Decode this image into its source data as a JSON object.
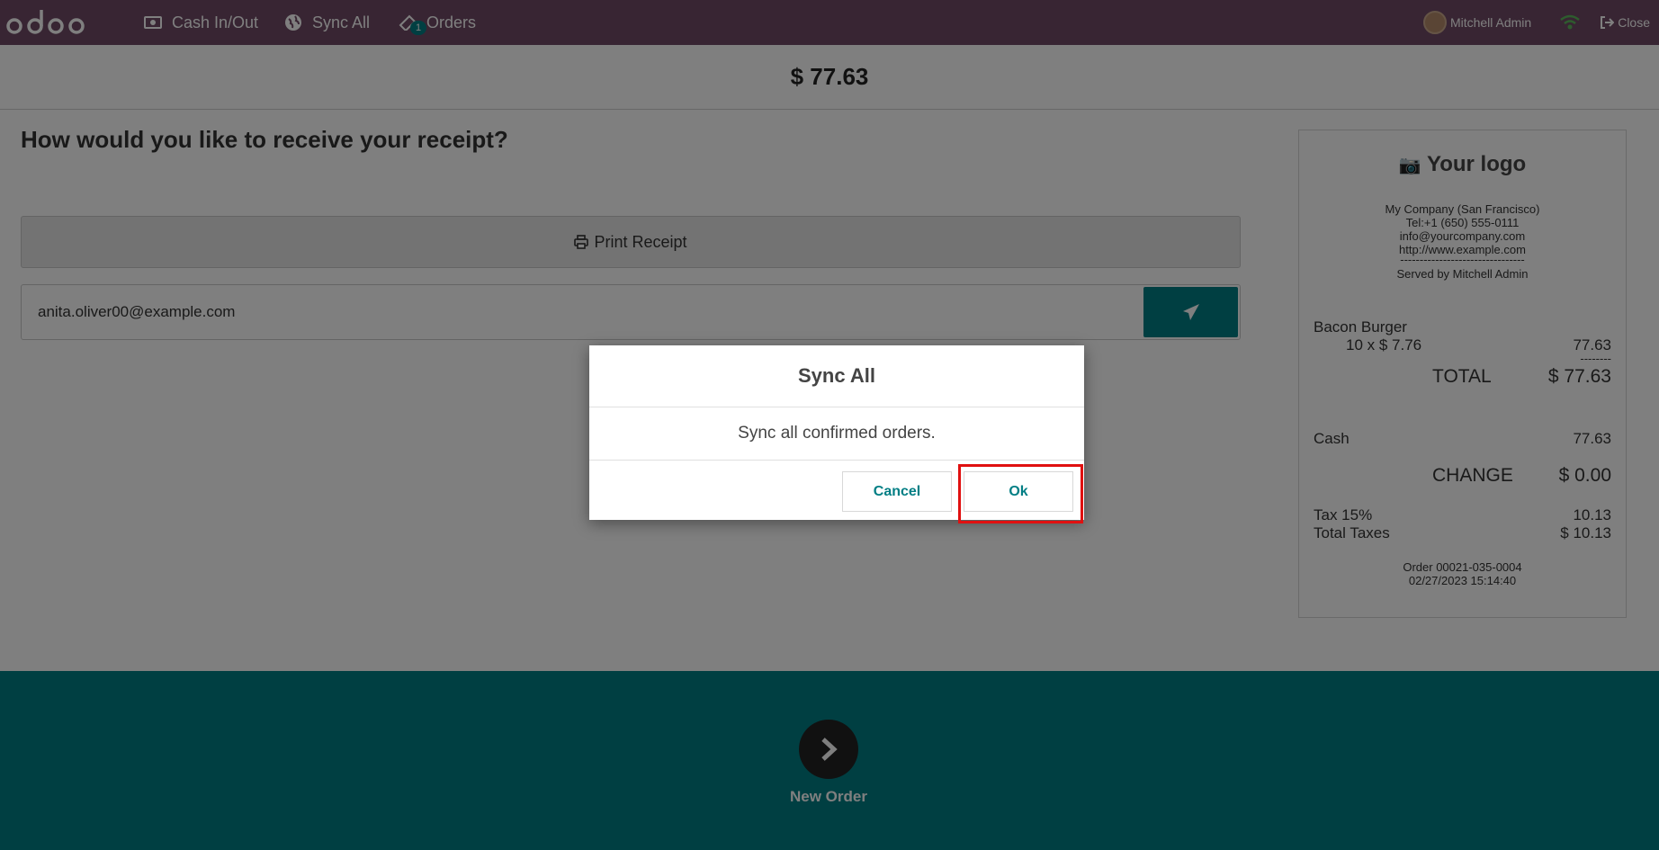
{
  "nav": {
    "cash_label": "Cash In/Out",
    "sync_label": "Sync All",
    "orders_label": "Orders",
    "orders_badge": "1",
    "user_name": "Mitchell Admin",
    "close_label": "Close"
  },
  "amount": "$ 77.63",
  "receipt_screen": {
    "heading": "How would you like to receive your receipt?",
    "print_label": "Print Receipt",
    "email_value": "anita.oliver00@example.com"
  },
  "receipt": {
    "logo_text": "Your logo",
    "company": "My Company (San Francisco)",
    "tel": "Tel:+1 (650) 555-0111",
    "email": "info@yourcompany.com",
    "website": "http://www.example.com",
    "dashes": "--------------------------------",
    "served_by": "Served by Mitchell Admin",
    "item_name": "Bacon Burger",
    "item_qty": "10 x $ 7.76",
    "item_total": "77.63",
    "item_dashes": "--------",
    "total_label": "TOTAL",
    "total_value": "$ 77.63",
    "payment_label": "Cash",
    "payment_value": "77.63",
    "change_label": "CHANGE",
    "change_value": "$ 0.00",
    "tax_label": "Tax 15%",
    "tax_value": "10.13",
    "total_taxes_label": "Total Taxes",
    "total_taxes_value": "$ 10.13",
    "order_ref": "Order 00021-035-0004",
    "order_date": "02/27/2023 15:14:40"
  },
  "footer": {
    "new_order_label": "New Order"
  },
  "dialog": {
    "title": "Sync All",
    "body": "Sync all confirmed orders.",
    "cancel_label": "Cancel",
    "ok_label": "Ok"
  },
  "colors": {
    "brand": "#714b67",
    "accent": "#017e84",
    "highlight": "#e01010"
  }
}
